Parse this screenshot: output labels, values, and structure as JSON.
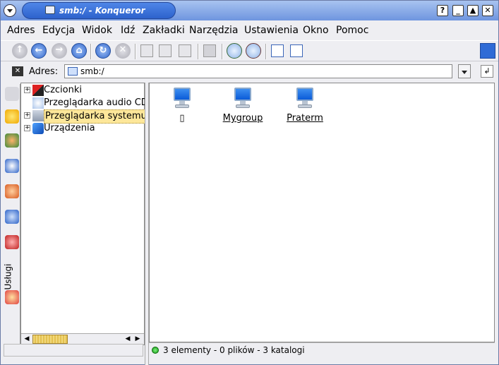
{
  "window": {
    "title": "smb:/ - Konqueror",
    "buttons": {
      "help": "?",
      "minimize": "_",
      "maximize": "▲",
      "close": "✕"
    }
  },
  "menubar": {
    "items": [
      "Adres",
      "Edycja",
      "Widok",
      "Idź",
      "Zakładki",
      "Narzędzia",
      "Ustawienia",
      "Okno",
      "Pomoc"
    ]
  },
  "toolbar": {
    "icons": [
      "up-icon",
      "back-icon",
      "forward-icon",
      "home-icon",
      "reload-icon",
      "stop-icon",
      "cut-icon",
      "copy-icon",
      "paste-icon",
      "print-icon",
      "zoom-in-icon",
      "zoom-out-icon",
      "icon-view-icon",
      "tree-view-icon",
      "gear-icon"
    ]
  },
  "location": {
    "label": "Adres:",
    "value": "smb:/"
  },
  "sidebar": {
    "tab_label": "Usługi",
    "tree": [
      {
        "label": "Czcionki",
        "expandable": true,
        "selected": false
      },
      {
        "label": "Przeglądarka audio CD",
        "expandable": false,
        "selected": false
      },
      {
        "label": "Przeglądarka systemu",
        "expandable": true,
        "selected": true
      },
      {
        "label": "Urządzenia",
        "expandable": true,
        "selected": false
      }
    ],
    "scroll_position": 0.0
  },
  "main": {
    "items": [
      {
        "label": "▯",
        "icon": "computer-icon"
      },
      {
        "label": "Mygroup",
        "icon": "computer-icon"
      },
      {
        "label": "Praterm",
        "icon": "computer-icon"
      }
    ]
  },
  "status": {
    "text": "3 elementy - 0 plików - 3 katalogi"
  },
  "colors": {
    "titlebar": "#5f86d9",
    "selection": "#fde79a",
    "status_ok": "#149b14"
  }
}
